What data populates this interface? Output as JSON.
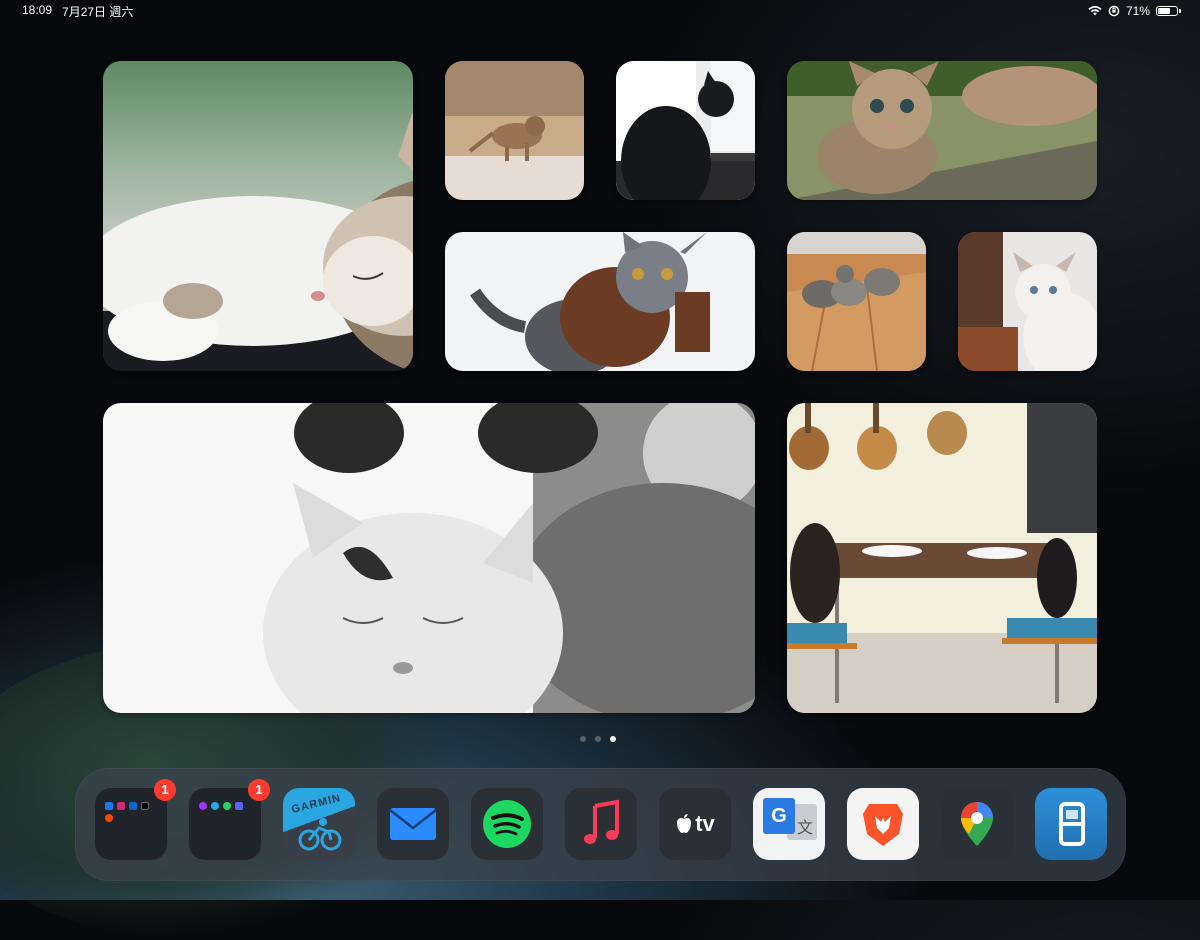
{
  "status": {
    "time": "18:09",
    "date": "7月27日 週六",
    "battery": "71%",
    "battery_level": 0.71
  },
  "widgets": [
    {
      "name": "sleeping-tabby-white-cat"
    },
    {
      "name": "running-kitten"
    },
    {
      "name": "black-cat-window"
    },
    {
      "name": "tabby-kittens"
    },
    {
      "name": "gray-cat-sweater"
    },
    {
      "name": "three-kittens-floor"
    },
    {
      "name": "white-kitten"
    },
    {
      "name": "cat-bunny-ears-bw"
    },
    {
      "name": "cats-kitchen-table"
    }
  ],
  "page_dots": {
    "count": 3,
    "active_index": 2
  },
  "dock": {
    "apps": [
      {
        "name": "social-folder",
        "badge": "1"
      },
      {
        "name": "messaging-folder",
        "badge": "1"
      },
      {
        "name": "garmin-app",
        "label": "GARMIN"
      },
      {
        "name": "mail-app"
      },
      {
        "name": "spotify-app"
      },
      {
        "name": "music-app"
      },
      {
        "name": "apple-tv-app",
        "label": "tv"
      },
      {
        "name": "google-translate-app",
        "label": "G"
      },
      {
        "name": "brave-app"
      },
      {
        "name": "google-maps-app"
      },
      {
        "name": "files-app"
      }
    ]
  },
  "colors": {
    "badge": "#ff3b30",
    "spotify": "#1ed760",
    "music": "#fa3c5a",
    "mail": "#2a8cff"
  }
}
